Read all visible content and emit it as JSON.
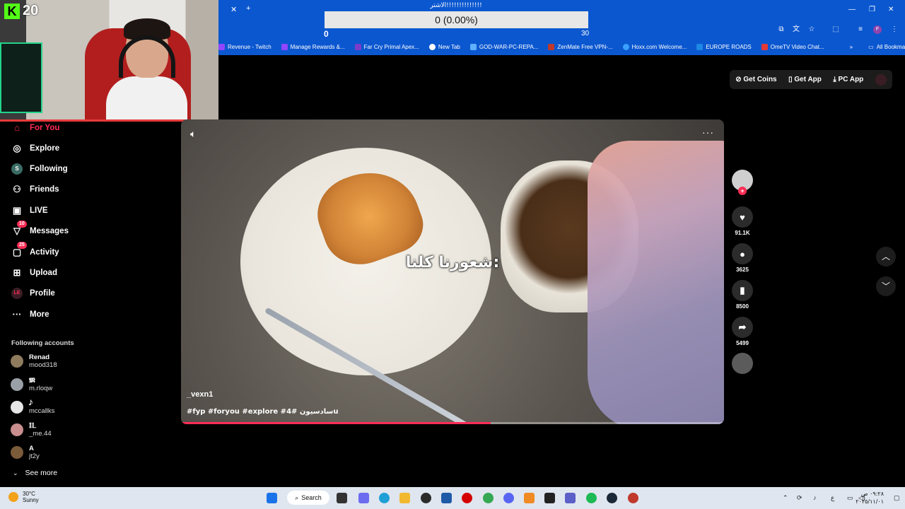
{
  "stream_overlay": {
    "kick_count": "20",
    "goal_title": "الاشتر!!!!!!!!!!!!!!",
    "goal_progress": "0 (0.00%)",
    "goal_min": "0",
    "goal_max": "30"
  },
  "browser": {
    "bookmarks": [
      {
        "label": "Revenue - Twitch",
        "color": "#9146ff"
      },
      {
        "label": "Manage Rewards &...",
        "color": "#9146ff"
      },
      {
        "label": "Far Cry Primal Apex...",
        "color": "#7a3cc9"
      },
      {
        "label": "New Tab",
        "color": "#ffffff"
      },
      {
        "label": "GOD-WAR-PC-REPA...",
        "color": "#5fb0ff"
      },
      {
        "label": "ZenMate Free VPN-...",
        "color": "#c0392b"
      },
      {
        "label": "Hoxx.com Welcome...",
        "color": "#3aa0ff"
      },
      {
        "label": "EUROPE ROADS",
        "color": "#1e88e5"
      },
      {
        "label": "OmeTV Video Chat...",
        "color": "#e53935"
      }
    ],
    "all_bookmarks": "All Bookmarks"
  },
  "sidebar": {
    "nav": [
      {
        "label": "For You",
        "icon": "home-icon",
        "active": true
      },
      {
        "label": "Explore",
        "icon": "compass-icon"
      },
      {
        "label": "Following",
        "icon": "following-icon"
      },
      {
        "label": "Friends",
        "icon": "friends-icon"
      },
      {
        "label": "LIVE",
        "icon": "live-icon"
      },
      {
        "label": "Messages",
        "icon": "messages-icon",
        "badge": "10"
      },
      {
        "label": "Activity",
        "icon": "activity-icon",
        "badge": "25"
      },
      {
        "label": "Upload",
        "icon": "upload-icon"
      },
      {
        "label": "Profile",
        "icon": "profile-icon"
      },
      {
        "label": "More",
        "icon": "more-icon"
      }
    ],
    "following_title": "Following accounts",
    "accounts": [
      {
        "name": "Renad",
        "handle": "mood318"
      },
      {
        "name": "𝕸",
        "handle": "m.rloqw"
      },
      {
        "name": "𝅘𝅥𝅮",
        "handle": "mccallks"
      },
      {
        "name": "𝕀𝕃",
        "handle": "_me.44"
      },
      {
        "name": "A",
        "handle": "jt2y"
      }
    ],
    "see_more": "See more"
  },
  "top_buttons": {
    "get_coins": "Get Coins",
    "get_app": "Get App",
    "pc_app": "PC App"
  },
  "video": {
    "caption": "شعورنا كلنا:",
    "author": "_vexn1",
    "tags": "#fyp #foryou #explore #سادسيون #4u",
    "progress": 0.57
  },
  "actions": {
    "likes": "91.1K",
    "comments": "3625",
    "saves": "8500",
    "shares": "5499"
  },
  "taskbar": {
    "temp": "30°C",
    "weather": "Sunny",
    "search": "Search",
    "clock_time": "٠٩:٢٨ ص",
    "clock_date": "٢٠٢٥/١١/٠١"
  },
  "colors": {
    "accent": "#fe2c55",
    "browser_blue": "#0b57d0",
    "kick_green": "#53fc18"
  }
}
